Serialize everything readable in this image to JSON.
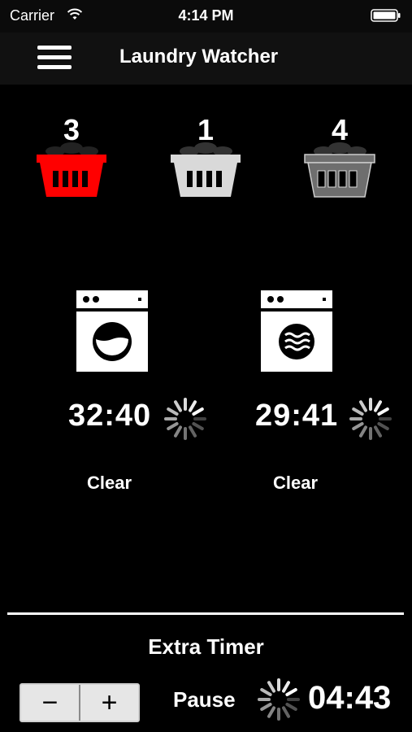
{
  "status": {
    "carrier": "Carrier",
    "time": "4:14 PM"
  },
  "nav": {
    "title": "Laundry Watcher",
    "menu_icon": "hamburger-menu-icon"
  },
  "baskets": [
    {
      "count": "3",
      "color": "#ff0000",
      "icon": "laundry-basket-icon"
    },
    {
      "count": "1",
      "color": "#d9d9d9",
      "icon": "laundry-basket-icon"
    },
    {
      "count": "4",
      "color": "#6e6e6e",
      "icon": "laundry-basket-icon"
    }
  ],
  "machines": [
    {
      "icon": "washing-machine-icon",
      "time": "32:40",
      "clear_label": "Clear"
    },
    {
      "icon": "dryer-icon",
      "time": "29:41",
      "clear_label": "Clear"
    }
  ],
  "extra": {
    "title": "Extra Timer",
    "minus_label": "−",
    "plus_label": "+",
    "pause_label": "Pause",
    "time": "04:43"
  }
}
